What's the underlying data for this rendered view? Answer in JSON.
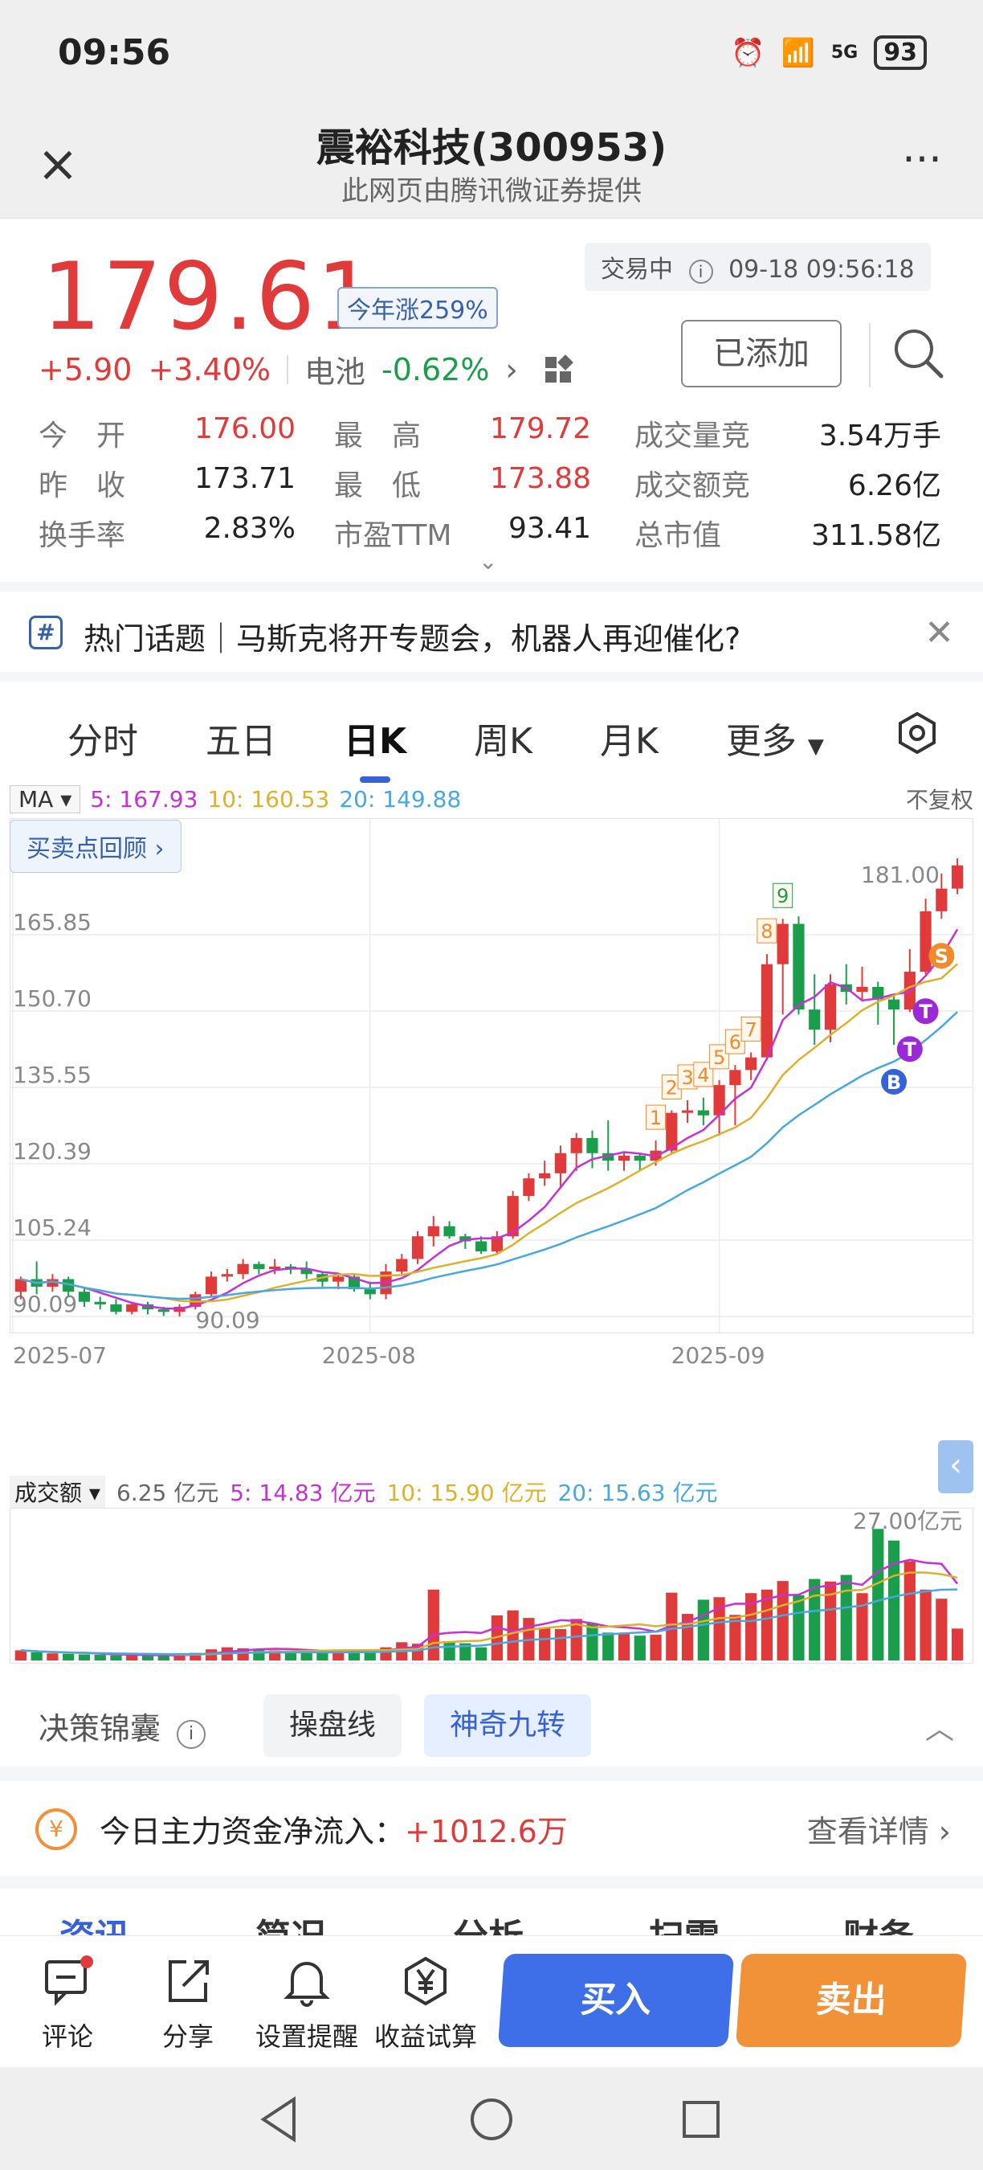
{
  "status_bar": {
    "time": "09:56",
    "signal_label": "5G",
    "battery": "93"
  },
  "header": {
    "title": "震裕科技(300953)",
    "subtitle": "此网页由腾讯微证券提供",
    "more": "···"
  },
  "quote": {
    "price": "179.61",
    "ytd_badge": "今年涨259%",
    "trade_status": "交易中",
    "trade_time": "09-18 09:56:18",
    "change": "+5.90",
    "change_pct": "+3.40%",
    "sector": "电池",
    "sector_pct": "-0.62%",
    "added_label": "已添加",
    "rows": [
      [
        [
          "今　开",
          "176.00",
          "red"
        ],
        [
          "最　高",
          "179.72",
          "red"
        ],
        [
          "成交量竞",
          "3.54万手",
          "dark"
        ]
      ],
      [
        [
          "昨　收",
          "173.71",
          "dark"
        ],
        [
          "最　低",
          "173.88",
          "red"
        ],
        [
          "成交额竞",
          "6.26亿",
          "dark"
        ]
      ],
      [
        [
          "换手率",
          "2.83%",
          "dark"
        ],
        [
          "市盈TTM",
          "93.41",
          "dark"
        ],
        [
          "总市值",
          "311.58亿",
          "dark"
        ]
      ]
    ]
  },
  "topic": {
    "text": "热门话题｜马斯克将开专题会，机器人再迎催化?"
  },
  "tabs": [
    "分时",
    "五日",
    "日K",
    "周K",
    "月K",
    "更多"
  ],
  "active_tab": "日K",
  "ma": {
    "select": "MA",
    "ma5": "5: 167.93",
    "ma10": "10: 160.53",
    "ma20": "20: 149.88",
    "adj": "不复权",
    "review": "买卖点回顾 ›"
  },
  "volume": {
    "select": "成交额",
    "current": "6.25 亿元",
    "v5": "5: 14.83 亿元",
    "v10": "10: 15.90 亿元",
    "v20": "20: 15.63 亿元",
    "max_label": "27.00亿元"
  },
  "chart_data": {
    "type": "candlestick",
    "price_ticks": [
      "165.85",
      "150.70",
      "135.55",
      "120.39",
      "105.24",
      "90.09"
    ],
    "price_tick_values": [
      165.85,
      150.7,
      135.55,
      120.39,
      105.24,
      90.09
    ],
    "ylim": [
      90.09,
      181.0
    ],
    "high_label": "181.00",
    "low_label": "90.09",
    "x_labels": [
      "2025-07",
      "2025-08",
      "2025-09"
    ],
    "x_label_index": [
      0,
      22,
      44
    ],
    "candles": [
      [
        95.0,
        97.5,
        93.5,
        98.0
      ],
      [
        97.5,
        96.0,
        94.5,
        101.0
      ],
      [
        96.0,
        97.5,
        95.0,
        98.5
      ],
      [
        97.5,
        95.0,
        94.0,
        98.0
      ],
      [
        95.0,
        93.0,
        92.0,
        96.0
      ],
      [
        93.0,
        92.5,
        91.5,
        94.0
      ],
      [
        92.5,
        91.0,
        90.5,
        93.5
      ],
      [
        91.0,
        92.5,
        90.5,
        93.0
      ],
      [
        92.5,
        91.5,
        90.5,
        93.0
      ],
      [
        91.5,
        91.0,
        90.2,
        92.0
      ],
      [
        91.0,
        92.0,
        90.09,
        92.5
      ],
      [
        92.0,
        94.5,
        91.5,
        95.0
      ],
      [
        94.5,
        98.0,
        94.0,
        99.0
      ],
      [
        98.0,
        98.5,
        97.0,
        99.5
      ],
      [
        98.5,
        100.5,
        97.5,
        101.5
      ],
      [
        100.5,
        99.5,
        98.5,
        101.0
      ],
      [
        99.5,
        100.0,
        98.5,
        101.5
      ],
      [
        100.0,
        99.5,
        98.5,
        100.5
      ],
      [
        99.5,
        98.5,
        97.5,
        101.0
      ],
      [
        98.5,
        97.0,
        96.0,
        99.0
      ],
      [
        97.0,
        98.0,
        95.5,
        98.5
      ],
      [
        98.0,
        95.5,
        95.0,
        98.5
      ],
      [
        95.5,
        94.5,
        93.5,
        97.0
      ],
      [
        94.5,
        99.0,
        93.5,
        100.5
      ],
      [
        99.0,
        101.5,
        98.5,
        102.5
      ],
      [
        101.5,
        106.0,
        100.5,
        107.0
      ],
      [
        106.0,
        108.0,
        104.0,
        110.0
      ],
      [
        108.0,
        106.0,
        105.5,
        109.0
      ],
      [
        106.0,
        105.0,
        103.5,
        106.5
      ],
      [
        105.0,
        103.0,
        102.5,
        106.0
      ],
      [
        103.0,
        106.0,
        102.5,
        107.0
      ],
      [
        106.0,
        114.0,
        105.5,
        115.0
      ],
      [
        114.0,
        117.5,
        113.0,
        118.5
      ],
      [
        117.5,
        118.5,
        116.0,
        121.0
      ],
      [
        118.5,
        122.5,
        115.5,
        124.0
      ],
      [
        122.5,
        125.5,
        119.0,
        126.5
      ],
      [
        125.5,
        122.5,
        119.5,
        127.0
      ],
      [
        122.5,
        121.0,
        119.0,
        129.0
      ],
      [
        121.0,
        122.0,
        119.0,
        122.5
      ],
      [
        122.0,
        121.0,
        119.0,
        122.5
      ],
      [
        121.0,
        123.0,
        120.0,
        125.0
      ],
      [
        123.0,
        130.5,
        122.5,
        131.0
      ],
      [
        130.5,
        131.0,
        128.5,
        133.0
      ],
      [
        131.0,
        130.0,
        128.0,
        133.5
      ],
      [
        130.0,
        136.0,
        126.0,
        137.0
      ],
      [
        136.0,
        139.0,
        128.0,
        140.0
      ],
      [
        139.0,
        141.5,
        137.0,
        142.5
      ],
      [
        141.5,
        160.0,
        141.0,
        162.0
      ],
      [
        160.0,
        168.0,
        150.0,
        169.0
      ],
      [
        168.0,
        151.0,
        150.0,
        169.5
      ],
      [
        151.0,
        147.0,
        144.0,
        158.0
      ],
      [
        147.0,
        156.0,
        144.5,
        158.0
      ],
      [
        156.0,
        154.5,
        152.0,
        160.0
      ],
      [
        154.5,
        155.5,
        153.0,
        159.5
      ],
      [
        155.5,
        153.0,
        148.0,
        156.5
      ],
      [
        153.0,
        151.0,
        144.0,
        154.0
      ],
      [
        151.0,
        158.5,
        150.5,
        163.0
      ],
      [
        158.5,
        170.5,
        158.0,
        173.0
      ],
      [
        170.5,
        175.0,
        169.0,
        178.0
      ],
      [
        175.0,
        179.61,
        173.88,
        181.0
      ]
    ],
    "markers": [
      {
        "label": "1",
        "i": 40,
        "color": "#f08a2a"
      },
      {
        "label": "2",
        "i": 41,
        "color": "#f08a2a"
      },
      {
        "label": "3",
        "i": 42,
        "color": "#f08a2a"
      },
      {
        "label": "4",
        "i": 43,
        "color": "#f08a2a"
      },
      {
        "label": "5",
        "i": 44,
        "color": "#f08a2a"
      },
      {
        "label": "6",
        "i": 45,
        "color": "#f08a2a"
      },
      {
        "label": "7",
        "i": 46,
        "color": "#f08a2a"
      },
      {
        "label": "8",
        "i": 47,
        "color": "#f08a2a"
      },
      {
        "label": "9",
        "i": 48,
        "color": "#1a9e4b"
      }
    ],
    "signals": [
      {
        "label": "B",
        "i": 55,
        "color": "#3761d8"
      },
      {
        "label": "T",
        "i": 56,
        "color": "#9a2ad8"
      },
      {
        "label": "T",
        "i": 57,
        "color": "#9a2ad8"
      },
      {
        "label": "S",
        "i": 58,
        "color": "#f08a2a"
      }
    ],
    "volume_max": 27.0,
    "volumes": [
      2.0,
      1.6,
      1.4,
      1.3,
      1.2,
      1.1,
      1.0,
      1.1,
      1.0,
      0.9,
      1.2,
      1.5,
      2.2,
      2.6,
      2.4,
      2.3,
      2.0,
      1.9,
      1.8,
      1.6,
      1.8,
      1.9,
      2.1,
      2.6,
      3.6,
      3.3,
      14.0,
      3.8,
      3.4,
      2.6,
      8.9,
      9.9,
      8.4,
      6.4,
      6.2,
      8.2,
      7.4,
      5.5,
      5.5,
      4.9,
      5.1,
      13.4,
      9.2,
      12.0,
      12.5,
      9.0,
      13.3,
      14.0,
      15.7,
      12.9,
      16.1,
      15.6,
      16.9,
      13.3,
      26.0,
      23.7,
      19.6,
      14.0,
      12.2,
      6.3
    ],
    "colors": {
      "up": "#e03a3a",
      "down": "#1a9e4b",
      "ma5": "#c531d4",
      "ma10": "#dcb12b",
      "ma20": "#47a8e0"
    }
  },
  "strategy": {
    "label": "决策锦囊",
    "btn1": "操盘线",
    "btn2": "神奇九转"
  },
  "fund": {
    "label": "今日主力资金净流入：",
    "value": "+1012.6万",
    "detail": "查看详情 ›"
  },
  "peek_tabs": [
    "资讯",
    "简况",
    "分析",
    "扫雷",
    "财务"
  ],
  "bottom": {
    "comment": "评论",
    "share": "分享",
    "alert": "设置提醒",
    "calc": "收益试算",
    "buy": "买入",
    "sell": "卖出"
  }
}
